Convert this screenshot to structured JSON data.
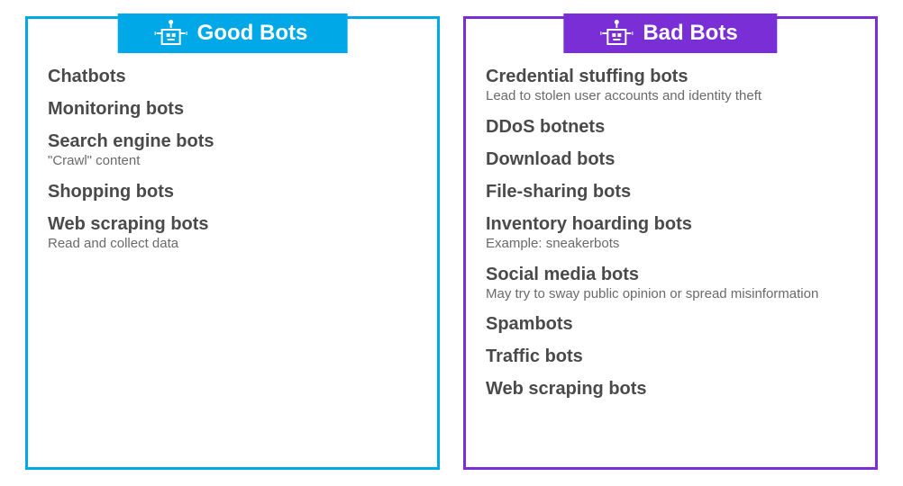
{
  "good": {
    "header": "Good Bots",
    "items": [
      {
        "title": "Chatbots",
        "desc": ""
      },
      {
        "title": "Monitoring bots",
        "desc": ""
      },
      {
        "title": "Search engine bots",
        "desc": "\"Crawl\" content"
      },
      {
        "title": "Shopping bots",
        "desc": ""
      },
      {
        "title": "Web scraping bots",
        "desc": "Read and collect data"
      }
    ]
  },
  "bad": {
    "header": "Bad Bots",
    "items": [
      {
        "title": "Credential stuffing bots",
        "desc": "Lead to stolen user accounts and identity theft"
      },
      {
        "title": "DDoS botnets",
        "desc": ""
      },
      {
        "title": "Download bots",
        "desc": ""
      },
      {
        "title": "File-sharing bots",
        "desc": ""
      },
      {
        "title": "Inventory hoarding bots",
        "desc": "Example: sneakerbots"
      },
      {
        "title": "Social media bots",
        "desc": "May try to sway public opinion or spread misinformation"
      },
      {
        "title": "Spambots",
        "desc": ""
      },
      {
        "title": "Traffic bots",
        "desc": ""
      },
      {
        "title": "Web scraping bots",
        "desc": ""
      }
    ]
  },
  "colors": {
    "good": "#00a8e8",
    "bad": "#7a2ed6"
  }
}
